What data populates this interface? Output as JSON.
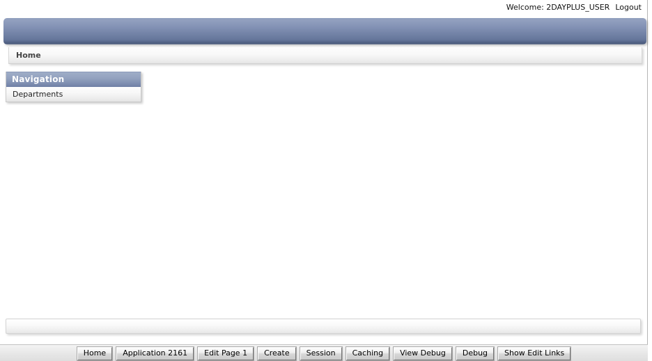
{
  "topbar": {
    "welcome": "Welcome: 2DAYPLUS_USER",
    "logout_label": "Logout"
  },
  "header": {
    "title": ""
  },
  "breadcrumb": {
    "items": [
      {
        "label": "Home"
      }
    ]
  },
  "sidebar": {
    "region_title": "Navigation",
    "items": [
      {
        "label": "Departments"
      }
    ]
  },
  "content": {
    "body_text": ""
  },
  "footer_region": {
    "text": ""
  },
  "dev_toolbar": {
    "buttons": [
      {
        "label": "Home"
      },
      {
        "label": "Application 2161"
      },
      {
        "label": "Edit Page 1"
      },
      {
        "label": "Create"
      },
      {
        "label": "Session"
      },
      {
        "label": "Caching"
      },
      {
        "label": "View Debug"
      },
      {
        "label": "Debug"
      },
      {
        "label": "Show Edit Links"
      }
    ]
  },
  "colors": {
    "header_blue_top": "#8d9cbb",
    "header_blue_bottom": "#4a5a7c",
    "nav_title_blue": "#93a2bf",
    "page_background": "#ffffff",
    "toolbar_background": "#eaeaea",
    "text_dark": "#333333"
  }
}
